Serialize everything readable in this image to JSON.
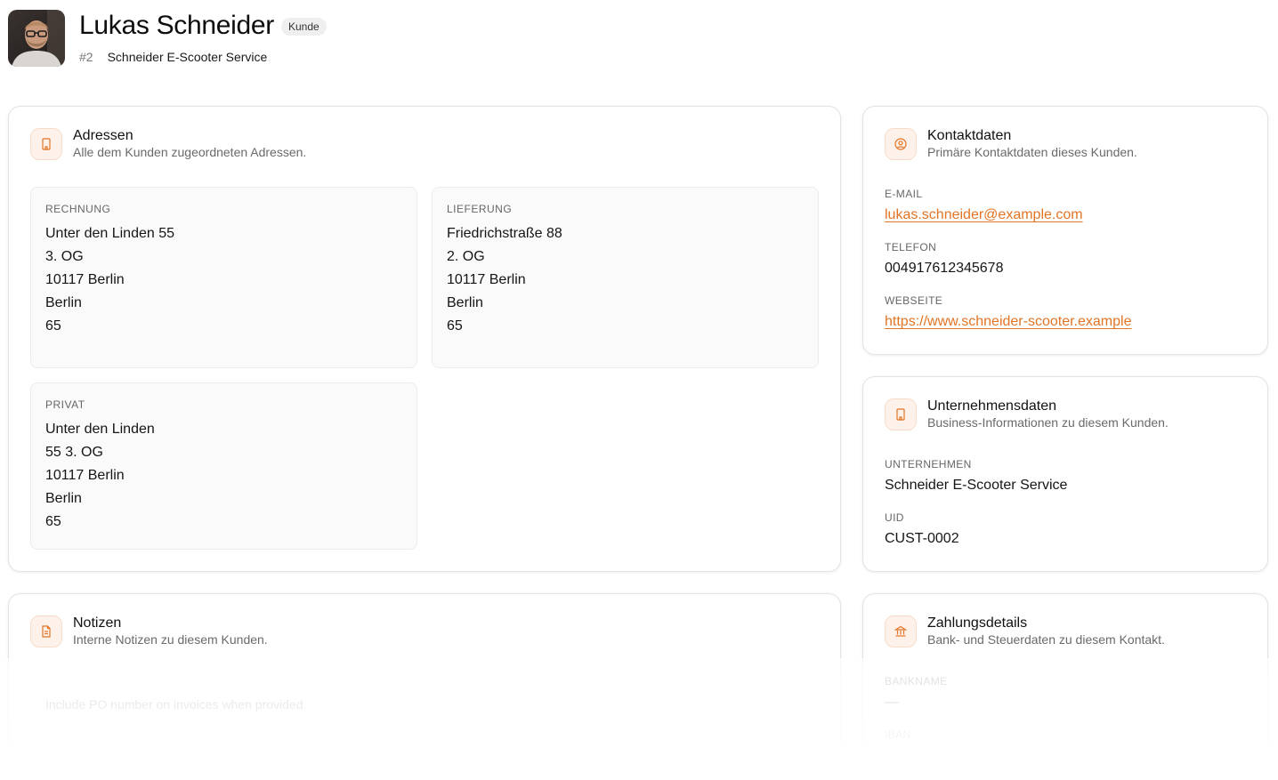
{
  "header": {
    "name": "Lukas Schneider",
    "badge": "Kunde",
    "id": "#2",
    "company": "Schneider E-Scooter Service"
  },
  "colors": {
    "accent": "#e27424",
    "icon_bg": "#fdf1ea"
  },
  "addresses": {
    "title": "Adressen",
    "description": "Alle dem Kunden zugeordneten Adressen.",
    "icon": "building-icon",
    "items": [
      {
        "label": "RECHNUNG",
        "lines": [
          "Unter den Linden 55",
          "3. OG",
          "10117 Berlin",
          "Berlin",
          "65"
        ]
      },
      {
        "label": "LIEFERUNG",
        "lines": [
          "Friedrichstraße 88",
          "2. OG",
          "10117 Berlin",
          "Berlin",
          "65"
        ]
      },
      {
        "label": "PRIVAT",
        "lines": [
          "Unter den Linden",
          "55 3. OG",
          "10117 Berlin",
          "Berlin",
          "65"
        ]
      }
    ]
  },
  "contact": {
    "title": "Kontaktdaten",
    "description": "Primäre Kontaktdaten dieses Kunden.",
    "icon": "user-circle-icon",
    "email_label": "E-MAIL",
    "email": "lukas.schneider@example.com",
    "phone_label": "TELEFON",
    "phone": "004917612345678",
    "website_label": "WEBSEITE",
    "website": "https://www.schneider-scooter.example"
  },
  "company": {
    "title": "Unternehmensdaten",
    "description": "Business-Informationen zu diesem Kunden.",
    "icon": "building-icon",
    "company_label": "UNTERNEHMEN",
    "company_value": "Schneider E-Scooter Service",
    "uid_label": "UID",
    "uid_value": "CUST-0002"
  },
  "notes": {
    "title": "Notizen",
    "description": "Interne Notizen zu diesem Kunden.",
    "icon": "document-icon",
    "text": "Include PO number on invoices when provided."
  },
  "payment": {
    "title": "Zahlungsdetails",
    "description": "Bank- und Steuerdaten zu diesem Kontakt.",
    "icon": "bank-icon",
    "bank_label": "BANKNAME",
    "bank_value": "—",
    "iban_label": "IBAN"
  }
}
